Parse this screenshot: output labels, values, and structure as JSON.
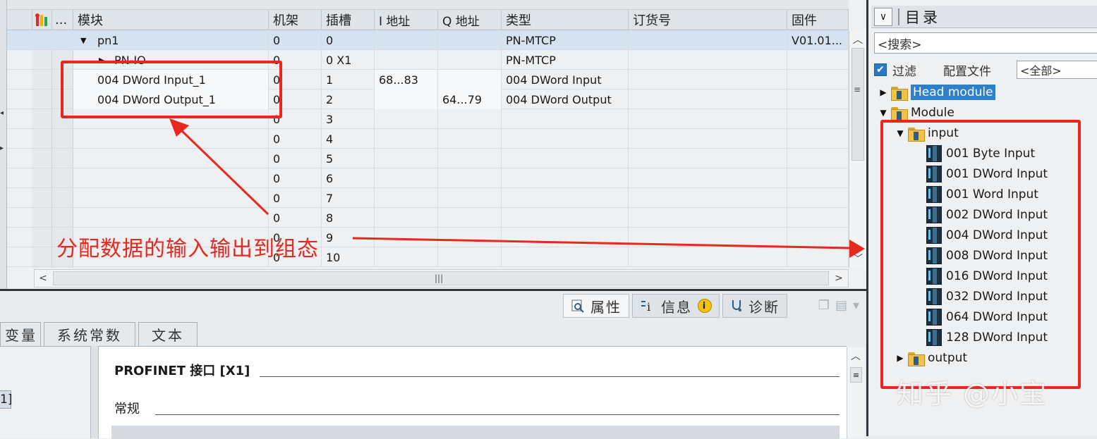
{
  "table": {
    "columns": [
      "...",
      "模块",
      "机架",
      "插槽",
      "I 地址",
      "Q 地址",
      "类型",
      "订货号",
      "固件"
    ],
    "rows": [
      {
        "module": "pn1",
        "rack": "0",
        "slot": "0",
        "i_addr": "",
        "q_addr": "",
        "type": "PN-MTCP",
        "order": "",
        "firmware": "V01.01..."
      },
      {
        "module": "PN-IO",
        "rack": "0",
        "slot": "0 X1",
        "i_addr": "",
        "q_addr": "",
        "type": "PN-MTCP",
        "order": "",
        "firmware": ""
      },
      {
        "module": "004 DWord Input_1",
        "rack": "0",
        "slot": "1",
        "i_addr": "68...83",
        "q_addr": "",
        "type": "004 DWord Input",
        "order": "",
        "firmware": ""
      },
      {
        "module": "004 DWord Output_1",
        "rack": "0",
        "slot": "2",
        "i_addr": "",
        "q_addr": "64...79",
        "type": "004 DWord Output",
        "order": "",
        "firmware": ""
      },
      {
        "module": "",
        "rack": "0",
        "slot": "3",
        "i_addr": "",
        "q_addr": "",
        "type": "",
        "order": "",
        "firmware": ""
      },
      {
        "module": "",
        "rack": "0",
        "slot": "4",
        "i_addr": "",
        "q_addr": "",
        "type": "",
        "order": "",
        "firmware": ""
      },
      {
        "module": "",
        "rack": "0",
        "slot": "5",
        "i_addr": "",
        "q_addr": "",
        "type": "",
        "order": "",
        "firmware": ""
      },
      {
        "module": "",
        "rack": "0",
        "slot": "6",
        "i_addr": "",
        "q_addr": "",
        "type": "",
        "order": "",
        "firmware": ""
      },
      {
        "module": "",
        "rack": "0",
        "slot": "7",
        "i_addr": "",
        "q_addr": "",
        "type": "",
        "order": "",
        "firmware": ""
      },
      {
        "module": "",
        "rack": "0",
        "slot": "8",
        "i_addr": "",
        "q_addr": "",
        "type": "",
        "order": "",
        "firmware": ""
      },
      {
        "module": "",
        "rack": "0",
        "slot": "9",
        "i_addr": "",
        "q_addr": "",
        "type": "",
        "order": "",
        "firmware": ""
      },
      {
        "module": "",
        "rack": "0",
        "slot": "10",
        "i_addr": "",
        "q_addr": "",
        "type": "",
        "order": "",
        "firmware": ""
      }
    ]
  },
  "annotation": {
    "text": "分配数据的输入输出到组态",
    "color": "#e8281e"
  },
  "inspector": {
    "tabs": [
      {
        "label": "属性",
        "icon": "properties-icon"
      },
      {
        "label": "信息",
        "icon": "info-icon"
      },
      {
        "label": "诊断",
        "icon": "diagnostics-icon"
      }
    ],
    "sub_tabs": [
      "变量",
      "系统常数",
      "文本"
    ],
    "left_fragment": "1]",
    "section_title": "PROFINET 接口 [X1]",
    "subsection": "常规"
  },
  "catalog": {
    "title": "目录",
    "search_placeholder": "<搜索>",
    "filter_label": "过滤",
    "profile_label": "配置文件",
    "profile_value": "<全部>",
    "tree": {
      "head_module": "Head module",
      "module": "Module",
      "input_folder": "input",
      "input_items": [
        "001 Byte Input",
        "001 DWord Input",
        "001 Word Input",
        "002 DWord Input",
        "004 DWord Input",
        "008 DWord Input",
        "016 DWord Input",
        "032 DWord Input",
        "064 DWord Input",
        "128 DWord Input"
      ],
      "output_folder": "output"
    }
  },
  "watermark": "知乎 @小宝",
  "colors": {
    "accent_red": "#e8281e",
    "selection_blue": "#2f7fc9"
  }
}
